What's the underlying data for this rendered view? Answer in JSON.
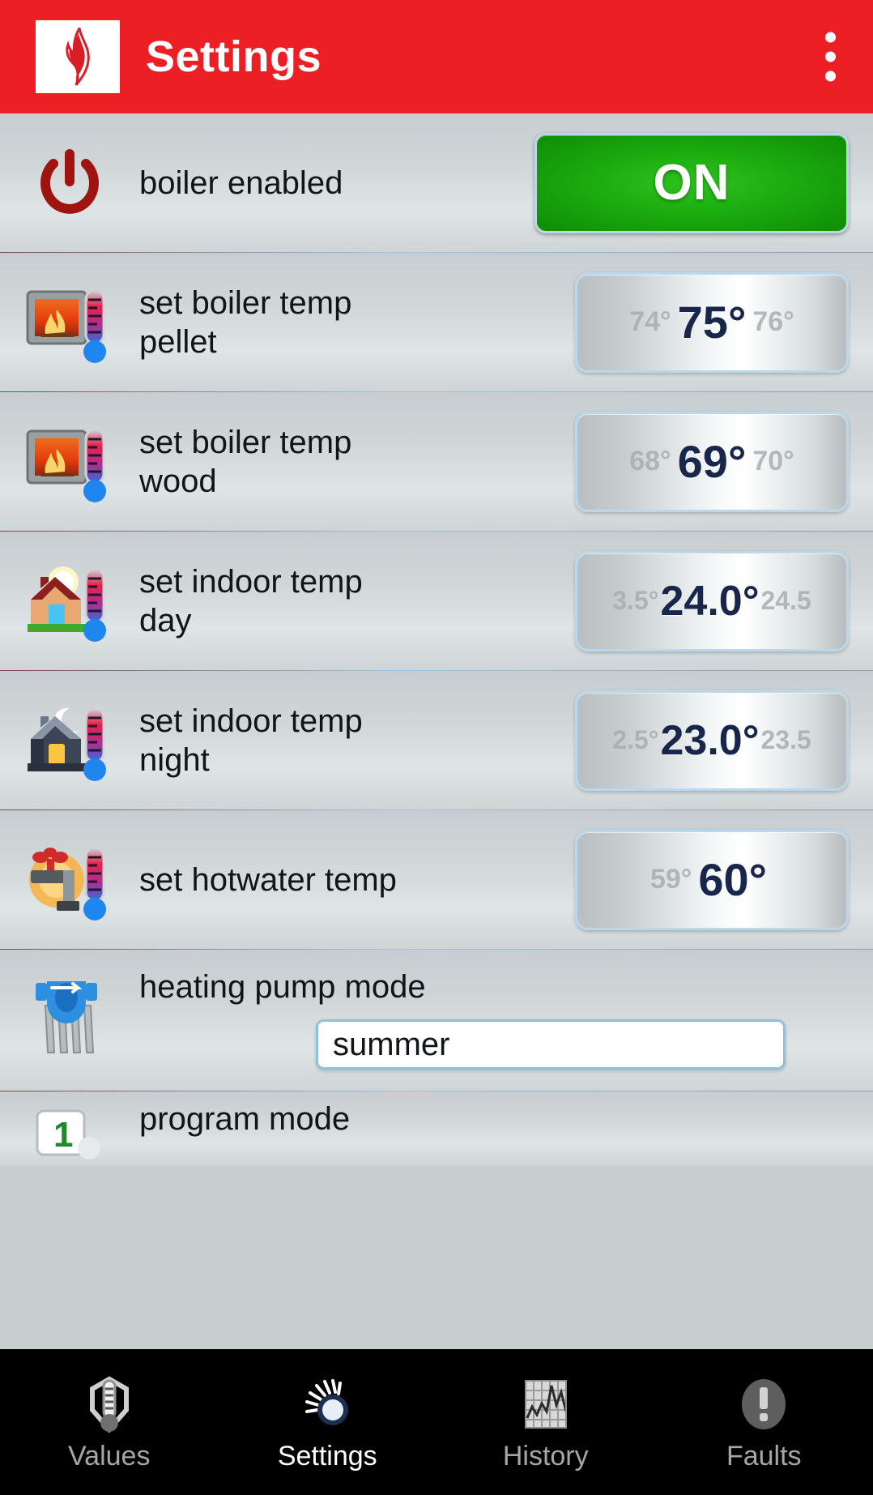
{
  "header": {
    "title": "Settings",
    "logo_icon": "flame-icon",
    "menu_icon": "overflow-menu-icon"
  },
  "rows": [
    {
      "id": "boiler-enabled",
      "icon": "power-icon",
      "label_line1": "boiler enabled",
      "label_line2": "",
      "control": "toggle",
      "value": "ON"
    },
    {
      "id": "set-boiler-temp-pellet",
      "icon": "stove-thermometer-icon",
      "label_line1": "set boiler temp",
      "label_line2": "pellet",
      "control": "number-picker",
      "prev": "74°",
      "value": "75°",
      "next": "76°"
    },
    {
      "id": "set-boiler-temp-wood",
      "icon": "stove-thermometer-icon",
      "label_line1": "set boiler temp",
      "label_line2": "wood",
      "control": "number-picker",
      "prev": "68°",
      "value": "69°",
      "next": "70°"
    },
    {
      "id": "set-indoor-temp-day",
      "icon": "house-sun-thermometer-icon",
      "label_line1": "set indoor temp",
      "label_line2": "day",
      "control": "number-picker-decimal",
      "prev": "3.5°",
      "value": "24.0°",
      "next": "24.5"
    },
    {
      "id": "set-indoor-temp-night",
      "icon": "house-moon-thermometer-icon",
      "label_line1": "set indoor temp",
      "label_line2": "night",
      "control": "number-picker-decimal",
      "prev": "2.5°",
      "value": "23.0°",
      "next": "23.5"
    },
    {
      "id": "set-hotwater-temp",
      "icon": "faucet-thermometer-icon",
      "label_line1": "set hotwater temp",
      "label_line2": "",
      "control": "number-picker",
      "prev": "59°",
      "value": "60°",
      "next": ""
    }
  ],
  "pump_row": {
    "id": "heating-pump-mode",
    "icon": "pump-radiator-icon",
    "label": "heating pump mode",
    "selected": "summer"
  },
  "last_row": {
    "id": "program-mode",
    "icon": "calendar-one-icon",
    "label": "program mode"
  },
  "tabs": [
    {
      "id": "values",
      "label": "Values",
      "icon": "gauge-thermometer-icon",
      "active": false
    },
    {
      "id": "settings",
      "label": "Settings",
      "icon": "dial-knob-icon",
      "active": true
    },
    {
      "id": "history",
      "label": "History",
      "icon": "line-chart-grid-icon",
      "active": false
    },
    {
      "id": "faults",
      "label": "Faults",
      "icon": "exclamation-circle-icon",
      "active": false
    }
  ],
  "colors": {
    "header_red": "#ec2024",
    "on_green": "#1db010",
    "picker_value_navy": "#17264a",
    "tab_active": "#ffffff",
    "tab_inactive": "#a6a6a6"
  }
}
